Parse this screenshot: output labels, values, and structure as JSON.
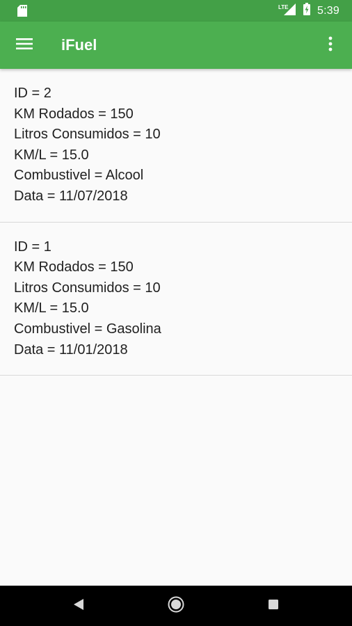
{
  "status_bar": {
    "time": "5:39",
    "network_label": "LTE",
    "icons": [
      "sd-card-icon",
      "lte-signal-icon",
      "battery-charging-icon"
    ]
  },
  "app_bar": {
    "title": "iFuel",
    "menu_icon": "hamburger-menu-icon",
    "overflow_icon": "more-vert-icon"
  },
  "records": [
    {
      "lines": [
        "ID = 2",
        "KM Rodados = 150",
        "Litros Consumidos = 10",
        "KM/L = 15.0",
        "Combustivel = Alcool",
        "Data = 11/07/2018"
      ]
    },
    {
      "lines": [
        "ID = 1",
        "KM Rodados = 150",
        "Litros Consumidos = 10",
        "KM/L = 15.0",
        "Combustivel = Gasolina",
        "Data = 11/01/2018"
      ]
    }
  ],
  "nav_bar": {
    "buttons": [
      "back-icon",
      "home-icon",
      "recents-icon"
    ]
  },
  "colors": {
    "primary": "#4caf50",
    "primary_dark": "#43a047",
    "background": "#fafafa",
    "text": "#212121",
    "divider": "#d9d9d9"
  }
}
